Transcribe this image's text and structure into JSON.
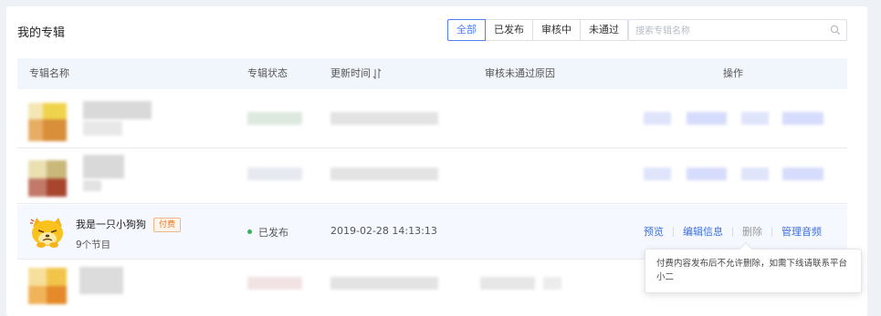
{
  "header": {
    "title": "我的专辑"
  },
  "filters": [
    {
      "label": "全部",
      "active": true
    },
    {
      "label": "已发布",
      "active": false
    },
    {
      "label": "审核中",
      "active": false
    },
    {
      "label": "未通过",
      "active": false
    }
  ],
  "search": {
    "placeholder": "搜索专辑名称",
    "value": ""
  },
  "table": {
    "columns": [
      "专辑名称",
      "专辑状态",
      "更新时间",
      "审核未通过原因",
      "操作"
    ],
    "visible_row": {
      "name": "我是一只小狗狗",
      "badge": "付费",
      "episodes": "9个节目",
      "status": "已发布",
      "updated": "2019-02-28 14:13:13",
      "reason": "",
      "actions": [
        "预览",
        "编辑信息",
        "删除",
        "管理音频"
      ]
    }
  },
  "tooltip": {
    "text": "付费内容发布后不允许删除，如需下线请联系平台小二"
  },
  "colors": {
    "accent": "#4f7df2",
    "link": "#3f6fdc",
    "badge": "#e07a2e",
    "published_dot": "#32b35a",
    "header_bg": "#f1f5fc"
  }
}
